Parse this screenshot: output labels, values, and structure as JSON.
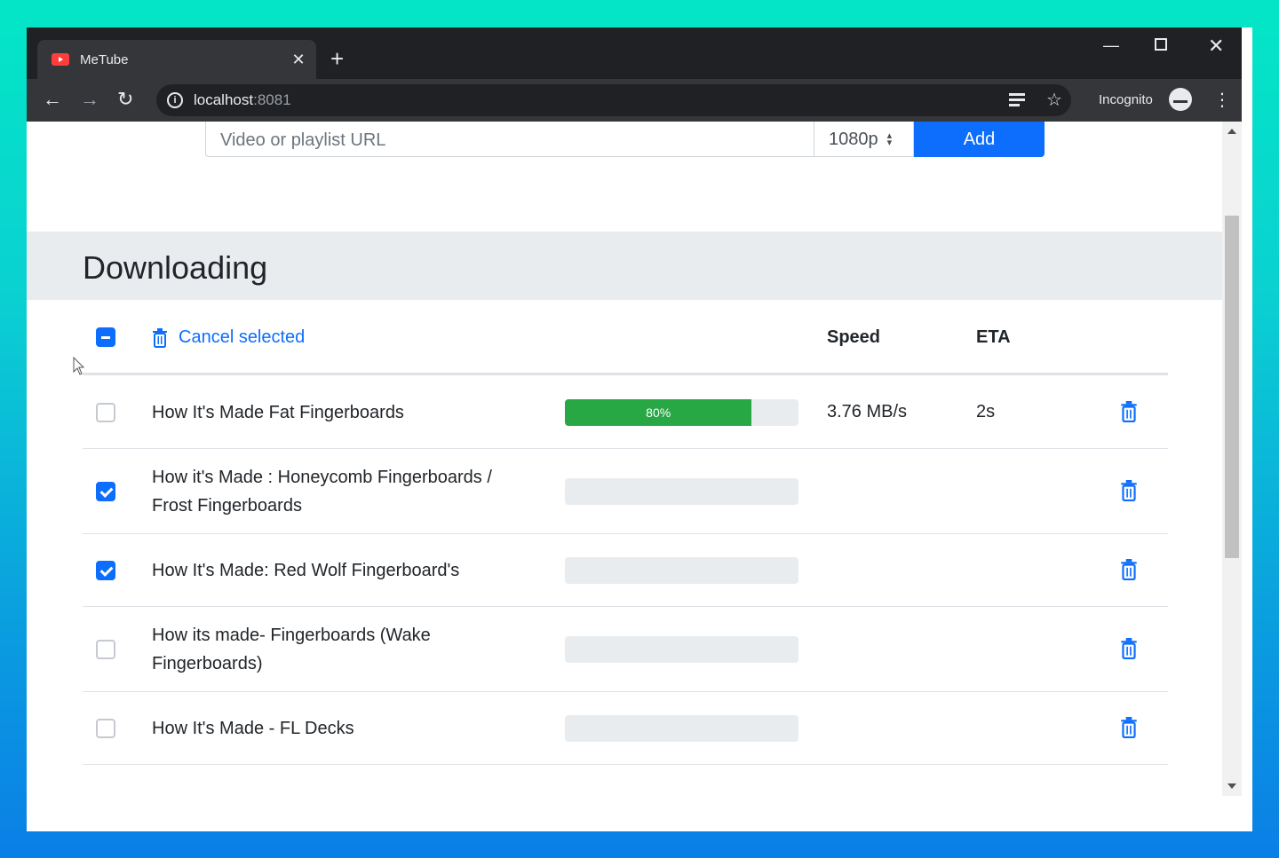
{
  "browser": {
    "tab_title": "MeTube",
    "url_host": "localhost",
    "url_port": ":8081",
    "incognito_label": "Incognito"
  },
  "add_form": {
    "url_placeholder": "Video or playlist URL",
    "quality_value": "1080p",
    "add_label": "Add"
  },
  "downloading": {
    "title": "Downloading",
    "cancel_selected_label": "Cancel selected",
    "columns": {
      "speed": "Speed",
      "eta": "ETA"
    },
    "rows": [
      {
        "title": "How It's Made Fat Fingerboards",
        "checked": false,
        "progress": 80,
        "progress_label": "80%",
        "speed": "3.76 MB/s",
        "eta": "2s"
      },
      {
        "title": "How it's Made : Honeycomb Fingerboards / Frost Fingerboards",
        "checked": true,
        "progress": 0,
        "progress_label": "",
        "speed": "",
        "eta": ""
      },
      {
        "title": "How It's Made: Red Wolf Fingerboard's",
        "checked": true,
        "progress": 0,
        "progress_label": "",
        "speed": "",
        "eta": ""
      },
      {
        "title": "How its made- Fingerboards (Wake Fingerboards)",
        "checked": false,
        "progress": 0,
        "progress_label": "",
        "speed": "",
        "eta": ""
      },
      {
        "title": "How It's Made - FL Decks",
        "checked": false,
        "progress": 0,
        "progress_label": "",
        "speed": "",
        "eta": ""
      }
    ]
  },
  "colors": {
    "accent": "#0d6efd",
    "progress": "#28a745",
    "header_bg": "#e9ecef"
  }
}
